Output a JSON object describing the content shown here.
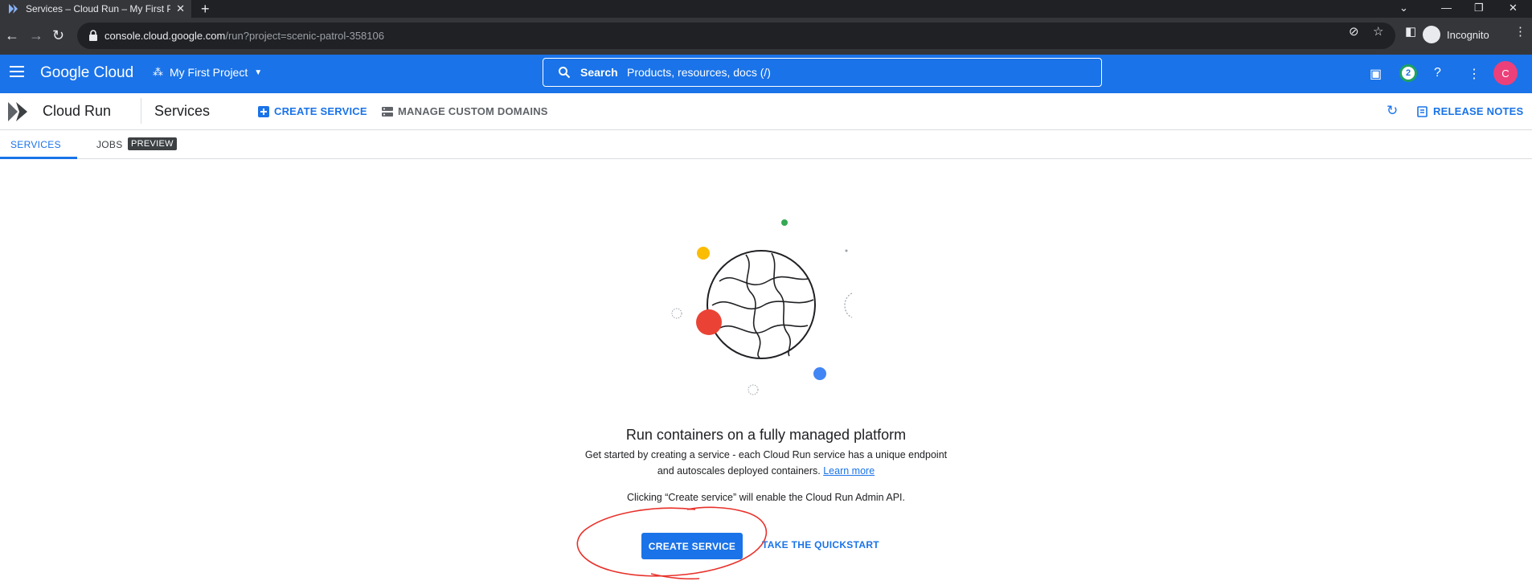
{
  "browser": {
    "tab_title": "Services – Cloud Run – My First P",
    "new_tab": "+",
    "url_host": "console.cloud.google.com",
    "url_path": "/run?project=scenic-patrol-358106",
    "incognito_label": "Incognito"
  },
  "header": {
    "logo": "Google Cloud",
    "project": "My First Project",
    "search_label": "Search",
    "search_placeholder": "Products, resources, docs (/)",
    "notification_count": "2",
    "avatar_initial": "C"
  },
  "productbar": {
    "product_name": "Cloud Run",
    "page_title": "Services",
    "create_service": "CREATE SERVICE",
    "manage_domains": "MANAGE CUSTOM DOMAINS",
    "release_notes": "RELEASE NOTES"
  },
  "tabs": {
    "services": "SERVICES",
    "jobs": "JOBS",
    "preview_badge": "PREVIEW"
  },
  "empty_state": {
    "title": "Run containers on a fully managed platform",
    "desc_line1": "Get started by creating a service - each Cloud Run service has a unique endpoint",
    "desc_line2": "and autoscales deployed containers.",
    "learn_more": "Learn more",
    "api_note": "Clicking “Create service” will enable the Cloud Run Admin API.",
    "primary_button": "CREATE SERVICE",
    "secondary_link": "TAKE THE QUICKSTART"
  },
  "colors": {
    "brand_blue": "#1a73e8",
    "avatar_pink": "#ec407a",
    "annotation_red": "#e8322b"
  }
}
